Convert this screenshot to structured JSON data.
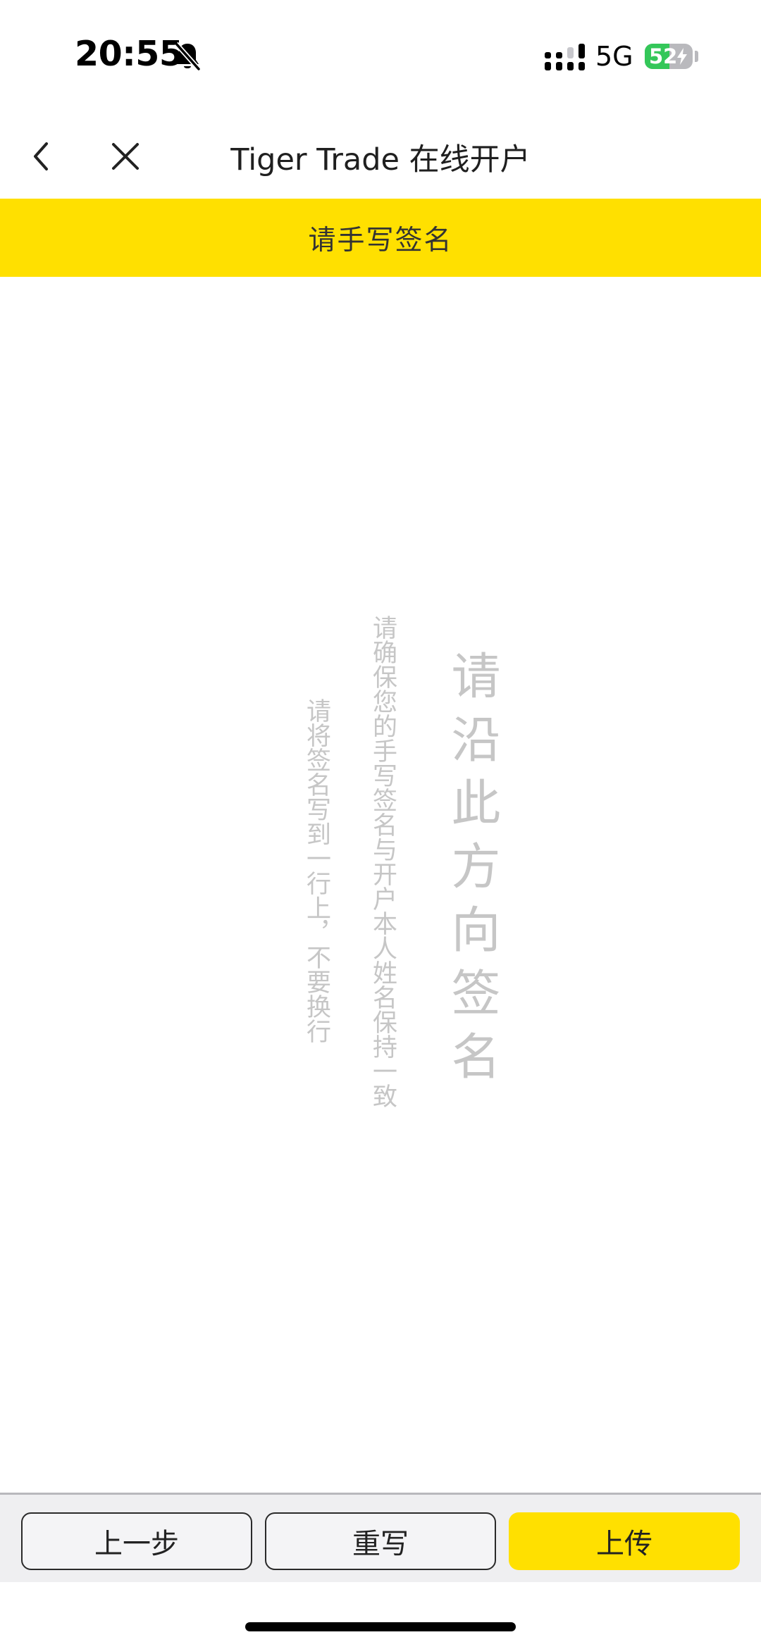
{
  "status_bar": {
    "time": "20:55",
    "network": "5G",
    "battery_level": "52",
    "battery_fraction": 0.52,
    "icons": [
      "bell-slash-icon",
      "signal-icon",
      "battery-icon",
      "charging-bolt-icon"
    ]
  },
  "nav": {
    "title": "Tiger Trade 在线开户",
    "icons": [
      "chevron-left-icon",
      "close-icon"
    ]
  },
  "banner": {
    "text": "请手写签名"
  },
  "signature_pad": {
    "guide_main": "请沿此方向签名",
    "guide_note_1": "请确保您的手写签名与开户本人姓名保持一致",
    "guide_note_2": "请将签名写到一行上，不要换行"
  },
  "toolbar": {
    "prev_label": "上一步",
    "rewrite_label": "重写",
    "upload_label": "上传"
  },
  "colors": {
    "accent": "#FFE000",
    "guide_text": "#C6C6C6",
    "battery_green": "#34C759",
    "toolbar_bg": "#EFEFF1"
  }
}
